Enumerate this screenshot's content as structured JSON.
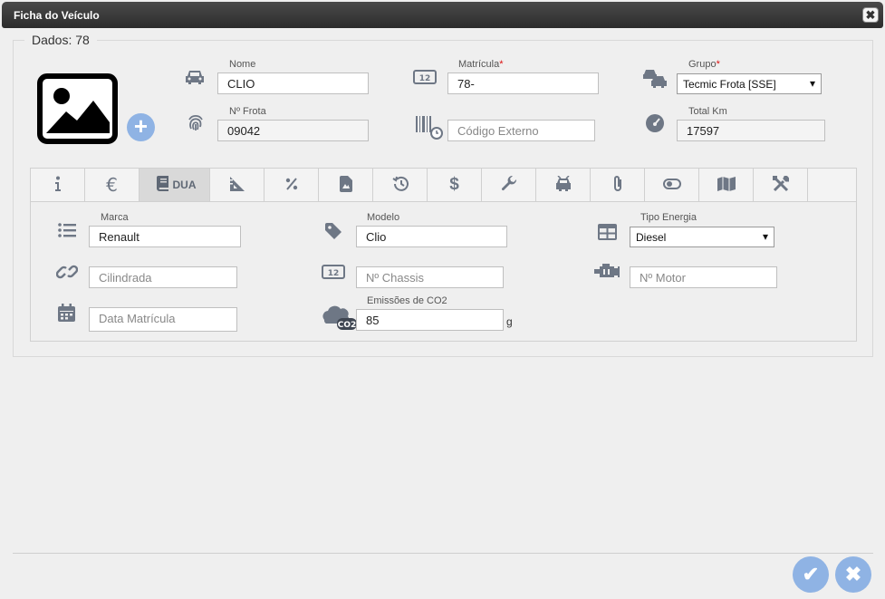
{
  "window": {
    "title": "Ficha do Veículo",
    "close_glyph": "✖"
  },
  "dados": {
    "legend": "Dados: 78",
    "nome": {
      "label": "Nome",
      "value": "CLIO"
    },
    "matricula": {
      "label": "Matrícula",
      "required_mark": "*",
      "value": "78-"
    },
    "grupo": {
      "label": "Grupo",
      "required_mark": "*",
      "selected": "Tecmic Frota [SSE]"
    },
    "n_frota": {
      "label": "Nº Frota",
      "value": "09042"
    },
    "codigo_externo": {
      "placeholder": "Código Externo"
    },
    "total_km": {
      "label": "Total Km",
      "value": "17597"
    }
  },
  "tabs": [
    {
      "icon": "info-icon"
    },
    {
      "icon": "euro-icon"
    },
    {
      "icon": "book-icon",
      "label": "DUA",
      "active": true
    },
    {
      "icon": "ruler-triangle-icon"
    },
    {
      "icon": "percent-icon"
    },
    {
      "icon": "document-icon"
    },
    {
      "icon": "history-icon"
    },
    {
      "icon": "dollar-icon"
    },
    {
      "icon": "wrench-icon"
    },
    {
      "icon": "car-front-icon"
    },
    {
      "icon": "paperclip-icon"
    },
    {
      "icon": "toggle-icon"
    },
    {
      "icon": "map-icon"
    },
    {
      "icon": "tools-icon"
    }
  ],
  "dua": {
    "marca": {
      "label": "Marca",
      "value": "Renault"
    },
    "modelo": {
      "label": "Modelo",
      "value": "Clio"
    },
    "tipo_energia": {
      "label": "Tipo Energia",
      "selected": "Diesel"
    },
    "cilindrada": {
      "placeholder": "Cilindrada"
    },
    "n_chassis": {
      "placeholder": "Nº Chassis"
    },
    "n_motor": {
      "placeholder": "Nº Motor"
    },
    "data_matricula": {
      "placeholder": "Data Matrícula"
    },
    "emissoes": {
      "label": "Emissões de CO2",
      "value": "85",
      "unit": "g",
      "badge": "CO2"
    }
  },
  "footer": {
    "confirm_glyph": "✔",
    "cancel_glyph": "✖"
  },
  "colors": {
    "accent": "#8fb3e4",
    "icon": "#6e7785",
    "titlebar": "#333333"
  }
}
